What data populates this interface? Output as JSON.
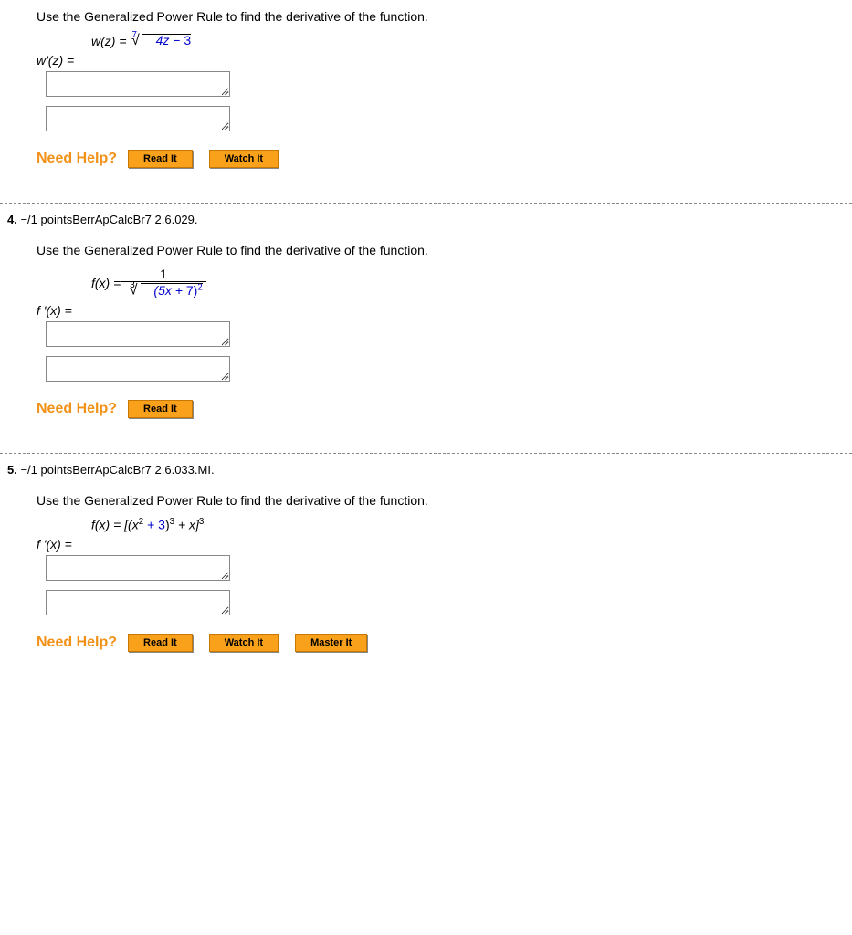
{
  "q3": {
    "instruction": "Use the Generalized Power Rule to find the derivative of the function.",
    "func_prefix": "w(z) = ",
    "root_index": "7",
    "root_inner_a": "4z",
    "root_inner_b": " − 3",
    "deriv_label": "w'(z) =",
    "help_label": "Need Help?",
    "buttons": {
      "read": "Read It",
      "watch": "Watch It"
    }
  },
  "q4": {
    "header_num": "4.",
    "header_points": " −/1 points",
    "header_source": "BerrApCalcBr7 2.6.029.",
    "instruction": "Use the Generalized Power Rule to find the derivative of the function.",
    "func_prefix": "f(x) = ",
    "frac_num": "1",
    "root_index": "3",
    "root_inner_a": "(5x + ",
    "root_inner_b": "7",
    "root_inner_c": ")",
    "root_inner_sup": "2",
    "deriv_label": "f '(x) =",
    "help_label": "Need Help?",
    "buttons": {
      "read": "Read It"
    }
  },
  "q5": {
    "header_num": "5.",
    "header_points": " −/1 points",
    "header_source": "BerrApCalcBr7 2.6.033.MI.",
    "instruction": "Use the Generalized Power Rule to find the derivative of the function.",
    "func_prefix": "f(x) = [(x",
    "sup2": "2",
    "plus3": " + 3",
    "cp1_sup3": ")",
    "sup3a": "3",
    "plusx": " + x]",
    "sup3b": "3",
    "deriv_label": "f '(x) =",
    "help_label": "Need Help?",
    "buttons": {
      "read": "Read It",
      "watch": "Watch It",
      "master": "Master It"
    }
  }
}
